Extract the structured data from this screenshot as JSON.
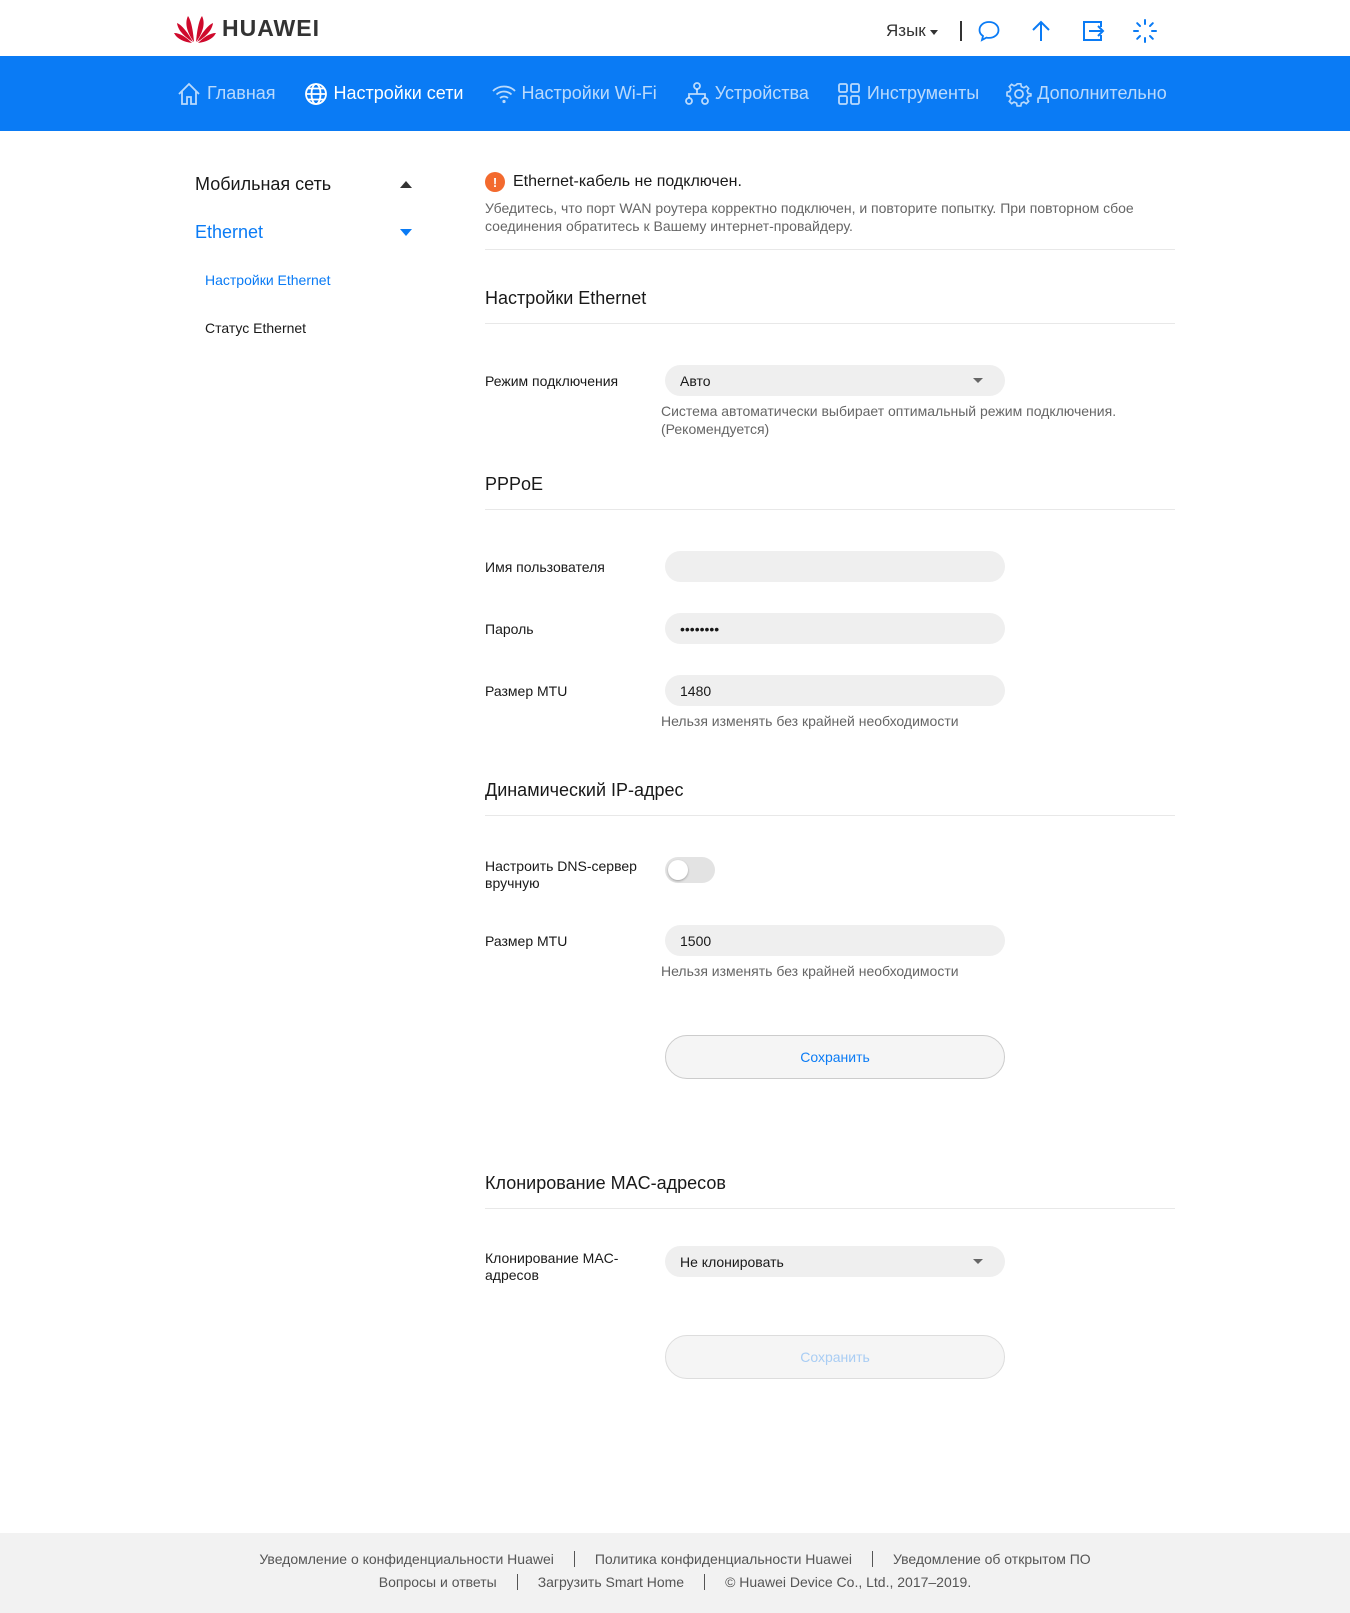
{
  "brand": {
    "name": "HUAWEI",
    "logo_color": "#cf0a2c"
  },
  "topbar": {
    "language_label": "Язык",
    "icons": [
      "message-icon",
      "upload-icon",
      "logout-icon",
      "loading-icon"
    ]
  },
  "nav": {
    "items": [
      {
        "label": "Главная",
        "icon": "home-icon"
      },
      {
        "label": "Настройки сети",
        "icon": "globe-icon",
        "active": true
      },
      {
        "label": "Настройки Wi-Fi",
        "icon": "wifi-icon"
      },
      {
        "label": "Устройства",
        "icon": "devices-icon"
      },
      {
        "label": "Инструменты",
        "icon": "tools-icon"
      },
      {
        "label": "Дополнительно",
        "icon": "gear-icon"
      }
    ],
    "accent_color": "#0a7bf5"
  },
  "sidebar": {
    "groups": [
      {
        "label": "Мобильная сеть"
      },
      {
        "label": "Ethernet",
        "expanded": true
      }
    ],
    "sub_items": [
      {
        "label": "Настройки Ethernet",
        "active": true
      },
      {
        "label": "Статус Ethernet"
      }
    ]
  },
  "alert": {
    "title": "Ethernet-кабель не подключен.",
    "body": "Убедитесь, что порт WAN роутера корректно подключен, и повторите попытку. При повторном сбое соединения обратитесь к Вашему интернет-провайдеру.",
    "icon_mark": "!",
    "color": "#f36a2e"
  },
  "ethernet_settings": {
    "title": "Настройки Ethernet",
    "mode_label": "Режим подключения",
    "mode_value": "Авто",
    "mode_hint": "Система автоматически выбирает оптимальный режим подключения. (Рекомендуется)"
  },
  "pppoe": {
    "title": "PPPoE",
    "username_label": "Имя пользователя",
    "username_value": "",
    "password_label": "Пароль",
    "password_value": "••••••••",
    "mtu_label": "Размер MTU",
    "mtu_value": "1480",
    "mtu_hint": "Нельзя изменять без крайней необходимости"
  },
  "dynamic_ip": {
    "title": "Динамический IP-адрес",
    "dns_label": "Настроить DNS-сервер вручную",
    "dns_enabled": false,
    "mtu_label": "Размер MTU",
    "mtu_value": "1500",
    "mtu_hint": "Нельзя изменять без крайней необходимости",
    "save_label": "Сохранить"
  },
  "mac_clone": {
    "title": "Клонирование MAC-адресов",
    "label": "Клонирование MAC-адресов",
    "value": "Не клонировать",
    "save_label": "Сохранить"
  },
  "footer": {
    "row1": [
      "Уведомление о конфиденциальности Huawei",
      "Политика конфиденциальности Huawei",
      "Уведомление об открытом ПО"
    ],
    "row2": [
      "Вопросы и ответы",
      "Загрузить Smart Home",
      "© Huawei Device Co., Ltd., 2017–2019."
    ]
  }
}
